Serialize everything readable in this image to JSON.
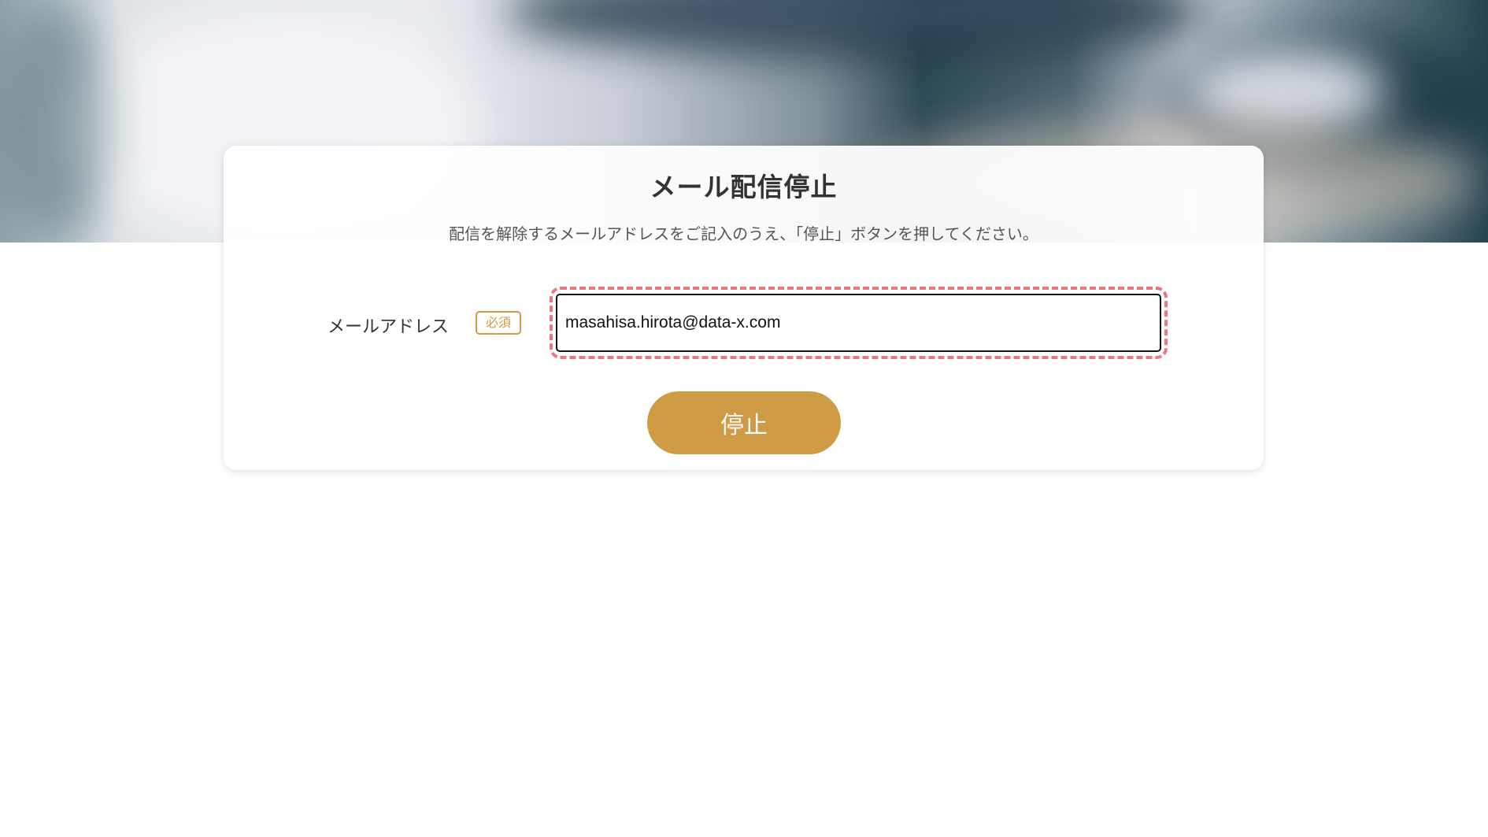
{
  "page": {
    "title": "メール配信停止",
    "description": "配信を解除するメールアドレスをご記入のうえ、「停止」ボタンを押してください。"
  },
  "form": {
    "email_label": "メールアドレス",
    "required_badge": "必須",
    "email_value": "masahisa.hirota@data-x.com",
    "submit_label": "停止"
  },
  "colors": {
    "accent": "#cf9b45",
    "highlight": "#ec7680"
  }
}
